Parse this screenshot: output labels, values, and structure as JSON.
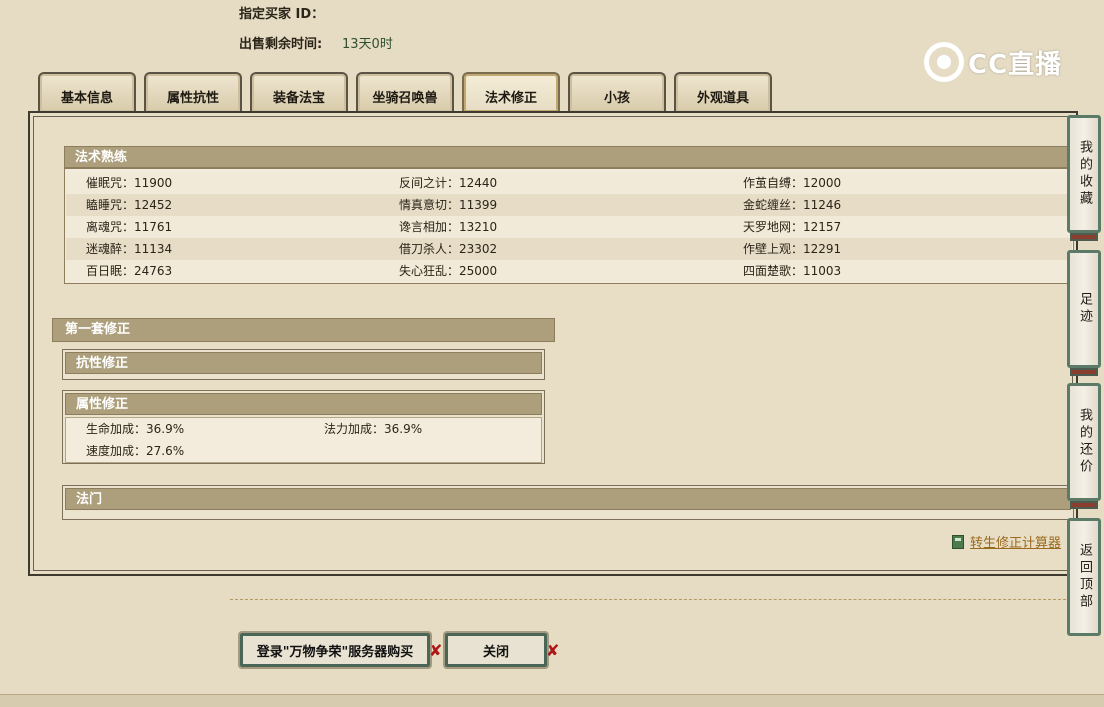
{
  "header": {
    "buyer_label": "指定买家 ID：",
    "time_label": "出售剩余时间:",
    "time_value": "13天0时"
  },
  "logo": {
    "text": "CC直播"
  },
  "tabs": [
    {
      "label": "基本信息"
    },
    {
      "label": "属性抗性"
    },
    {
      "label": "装备法宝"
    },
    {
      "label": "坐骑召唤兽"
    },
    {
      "label": "法术修正"
    },
    {
      "label": "小孩"
    },
    {
      "label": "外观道具"
    }
  ],
  "active_tab": "法术修正",
  "spell_mastery": {
    "title": "法术熟练",
    "rows": [
      [
        "催眠咒：11900",
        "反间之计：12440",
        "作茧自缚：12000"
      ],
      [
        "瞌睡咒：12452",
        "情真意切：11399",
        "金蛇缠丝：11246"
      ],
      [
        "离魂咒：11761",
        "谗言相加：13210",
        "天罗地网：12157"
      ],
      [
        "迷魂醉：11134",
        "借刀杀人：23302",
        "作壁上观：12291"
      ],
      [
        "百日眠：24763",
        "失心狂乱：25000",
        "四面楚歌：11003"
      ]
    ]
  },
  "first_set": {
    "title": "第一套修正",
    "resistance_title": "抗性修正",
    "attribute_title": "属性修正",
    "attributes": [
      "生命加成：36.9%",
      "法力加成：36.9%",
      "速度加成：27.6%"
    ]
  },
  "school": {
    "title": "法门"
  },
  "calc_link": "转生修正计算器",
  "buttons": {
    "buy": "登录\"万物争荣\"服务器购买",
    "close": "关闭"
  },
  "side": {
    "favorites": "我的收藏",
    "footprint": "足迹",
    "my_offer": "我的还价",
    "top": "返回顶部"
  }
}
